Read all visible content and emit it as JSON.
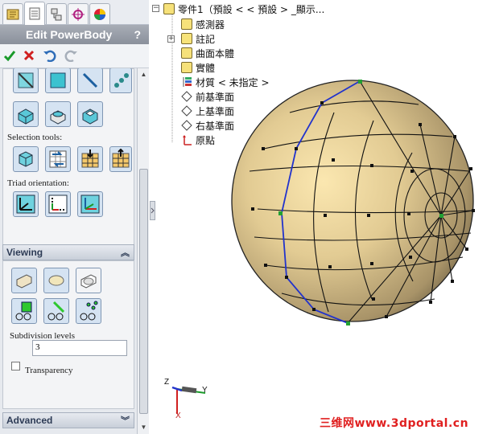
{
  "panel": {
    "title": "Edit PowerBody",
    "help": "?",
    "selection_tools_label": "Selection tools:",
    "triad_orientation_label": "Triad orientation:",
    "viewing_label": "Viewing",
    "subdivision_label": "Subdivision levels",
    "subdivision_value": "3",
    "transparency_label": "Transparency",
    "advanced_label": "Advanced"
  },
  "tree": {
    "root": "零件1（預設 < < 預設 > _顯示...",
    "items": [
      "感測器",
      "註記",
      "曲面本體",
      "實體",
      "材質 < 未指定 >",
      "前基準面",
      "上基準面",
      "右基準面",
      "原點"
    ]
  },
  "triad": {
    "x": "X",
    "y": "Y",
    "z": "Z"
  },
  "watermark": "三维网www.3dportal.cn",
  "colors": {
    "accent_blue": "#2f6db8",
    "body_tan": "#d9c28f",
    "ok_green": "#1a9a2a",
    "cancel_red": "#d02020"
  }
}
